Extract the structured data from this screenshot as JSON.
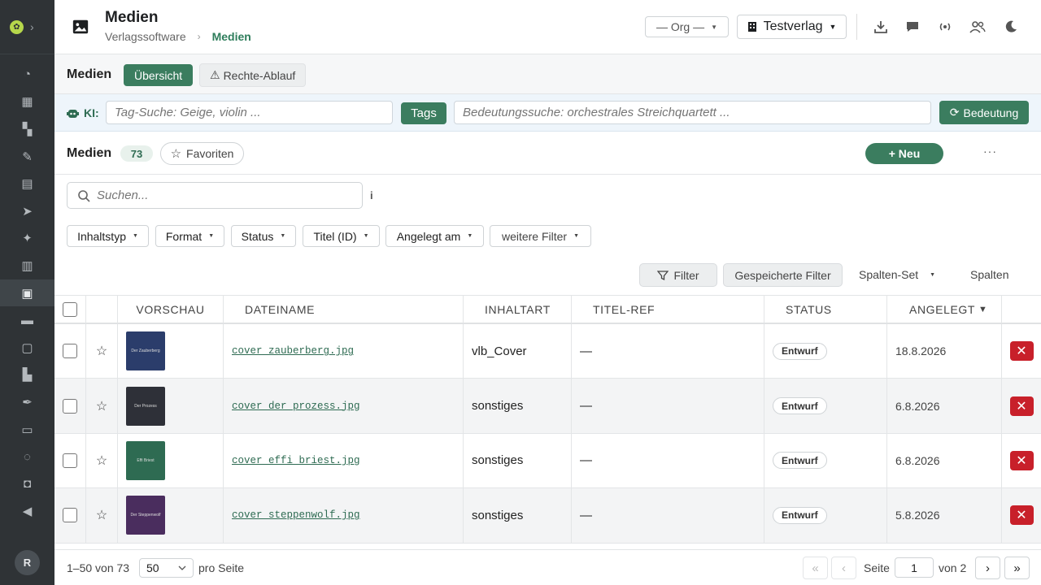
{
  "sidebar": {
    "items": [
      "dashboard-icon",
      "calendar-icon",
      "grid-icon",
      "user-edit-icon",
      "inbox-icon",
      "send-icon",
      "bulb-icon",
      "library-icon",
      "media-icon",
      "briefcase-icon",
      "contacts-icon",
      "books-icon",
      "feather-icon",
      "wallet-icon",
      "sync-icon",
      "bag-icon",
      "speaker-icon"
    ],
    "active_index": 8,
    "avatar": "R"
  },
  "header": {
    "title": "Medien",
    "breadcrumb_root": "Verlagssoftware",
    "breadcrumb_current": "Medien",
    "org_select": "— Org —",
    "tenant_select": "Testverlag"
  },
  "subnav": {
    "title": "Medien",
    "tab_overview": "Übersicht",
    "tab_rights": "Rechte-Ablauf",
    "tab_rights_icon": "⚠"
  },
  "ki": {
    "label": "KI:",
    "tag_placeholder": "Tag-Suche: Geige, violin ...",
    "tags_button": "Tags",
    "meaning_placeholder": "Bedeutungssuche: orchestrales Streichquartett ...",
    "meaning_button": "Bedeutung"
  },
  "list": {
    "title": "Medien",
    "count": "73",
    "favorites": "Favoriten",
    "new_button": "+ Neu",
    "more": "···",
    "search_placeholder": "Suchen...",
    "info": "i"
  },
  "filters": [
    "Inhaltstyp",
    "Format",
    "Status",
    "Titel (ID)",
    "Angelegt am",
    "weitere Filter"
  ],
  "toolbar": {
    "filter": "Filter",
    "saved_filter": "Gespeicherte Filter",
    "column_set": "Spalten-Set",
    "columns": "Spalten"
  },
  "table": {
    "headers": {
      "preview": "VORSCHAU",
      "filename": "DATEINAME",
      "content_type": "INHALTART",
      "title_ref": "TITEL-REF",
      "status": "STATUS",
      "created": "ANGELEGT",
      "sort_indicator": "▼"
    },
    "rows": [
      {
        "thumb_text": "Der Zauberberg",
        "thumb_color": "#2b3d6b",
        "filename": "cover_zauberberg.jpg",
        "content_type": "vlb_Cover",
        "title_ref": "—",
        "status": "Entwurf",
        "created": "18.8.2026"
      },
      {
        "thumb_text": "Der Prozess",
        "thumb_color": "#2e3038",
        "filename": "cover_der_prozess.jpg",
        "content_type": "sonstiges",
        "title_ref": "—",
        "status": "Entwurf",
        "created": "6.8.2026"
      },
      {
        "thumb_text": "Effi Briest",
        "thumb_color": "#2e6b52",
        "filename": "cover_effi_briest.jpg",
        "content_type": "sonstiges",
        "title_ref": "—",
        "status": "Entwurf",
        "created": "6.8.2026"
      },
      {
        "thumb_text": "Der Steppenwolf",
        "thumb_color": "#4a2d5e",
        "filename": "cover_steppenwolf.jpg",
        "content_type": "sonstiges",
        "title_ref": "—",
        "status": "Entwurf",
        "created": "5.8.2026"
      }
    ]
  },
  "footer": {
    "range": "1–50 von 73",
    "page_size": "50",
    "per_page": "pro Seite",
    "first": "«",
    "prev": "‹",
    "page_label": "Seite",
    "page": "1",
    "of_pages": "von 2",
    "next": "›",
    "last": "»"
  }
}
